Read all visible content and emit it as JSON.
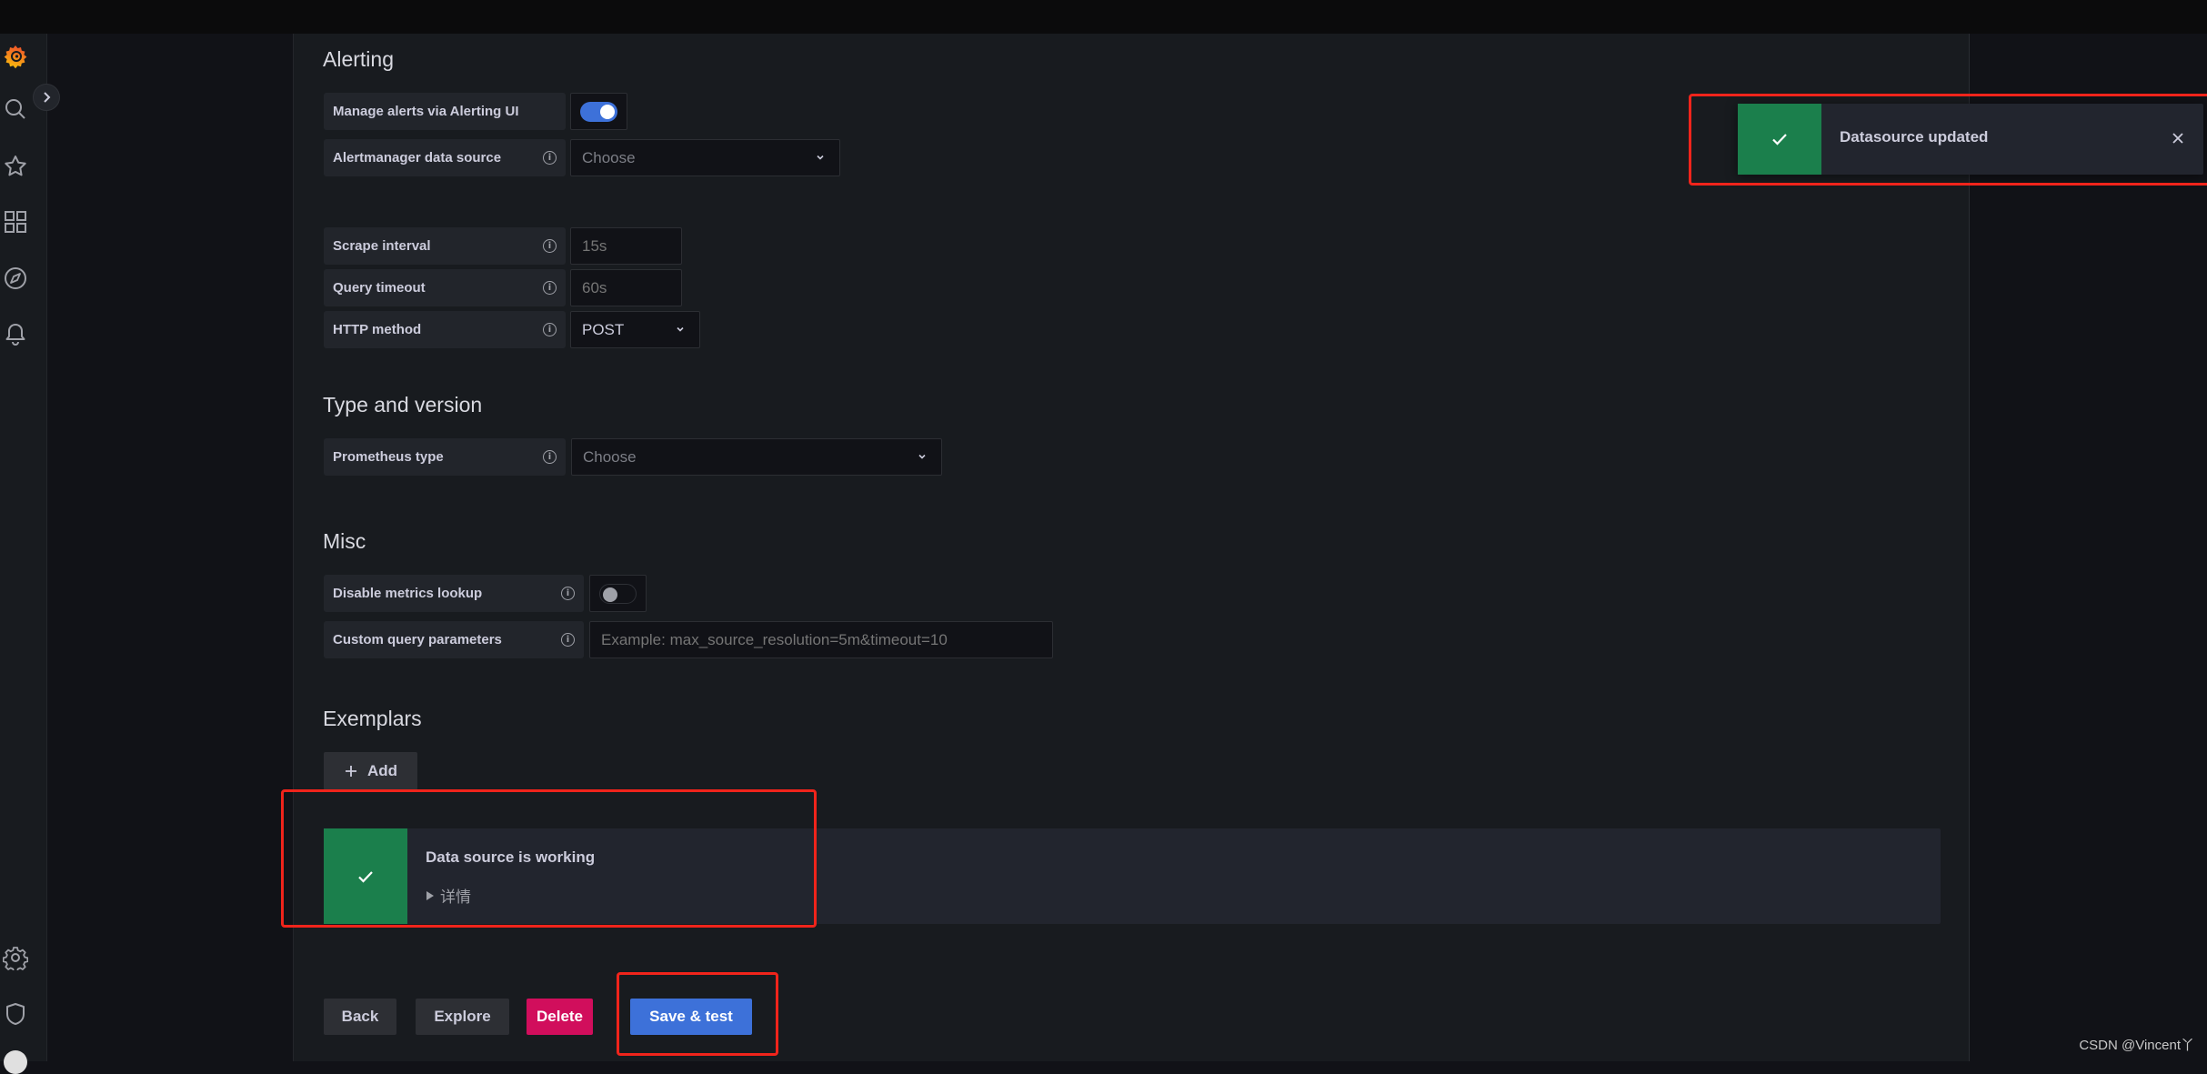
{
  "sidebar": {
    "items": [
      {
        "name": "grafana-logo",
        "label": "Home"
      },
      {
        "name": "search",
        "label": "Search"
      },
      {
        "name": "starred",
        "label": "Starred"
      },
      {
        "name": "dashboards",
        "label": "Dashboards"
      },
      {
        "name": "explore",
        "label": "Explore"
      },
      {
        "name": "alerting",
        "label": "Alerting"
      },
      {
        "name": "configuration",
        "label": "Configuration"
      },
      {
        "name": "server-admin",
        "label": "Server Admin"
      }
    ]
  },
  "sections": {
    "alerting": {
      "title": "Alerting",
      "manage_alerts_label": "Manage alerts via Alerting UI",
      "manage_alerts_enabled": true,
      "alertmanager_label": "Alertmanager data source",
      "alertmanager_placeholder": "Choose"
    },
    "http": {
      "scrape_interval_label": "Scrape interval",
      "scrape_interval_placeholder": "15s",
      "query_timeout_label": "Query timeout",
      "query_timeout_placeholder": "60s",
      "http_method_label": "HTTP method",
      "http_method_value": "POST"
    },
    "type_version": {
      "title": "Type and version",
      "prometheus_type_label": "Prometheus type",
      "prometheus_type_placeholder": "Choose"
    },
    "misc": {
      "title": "Misc",
      "disable_metrics_label": "Disable metrics lookup",
      "disable_metrics_enabled": false,
      "custom_query_label": "Custom query parameters",
      "custom_query_placeholder": "Example: max_source_resolution=5m&timeout=10"
    },
    "exemplars": {
      "title": "Exemplars",
      "add_label": "Add"
    }
  },
  "test_result": {
    "status": "success",
    "title": "Data source is working",
    "details_label": "详情"
  },
  "toast": {
    "status": "success",
    "message": "Datasource updated"
  },
  "actions": {
    "back": "Back",
    "explore": "Explore",
    "delete": "Delete",
    "save_test": "Save & test"
  },
  "colors": {
    "success": "#1b7f4c",
    "primary": "#3d71d9",
    "danger": "#d10e5c",
    "annotation": "#f0241b"
  },
  "info_glyph": "i",
  "watermark": "CSDN @Vincent丫"
}
